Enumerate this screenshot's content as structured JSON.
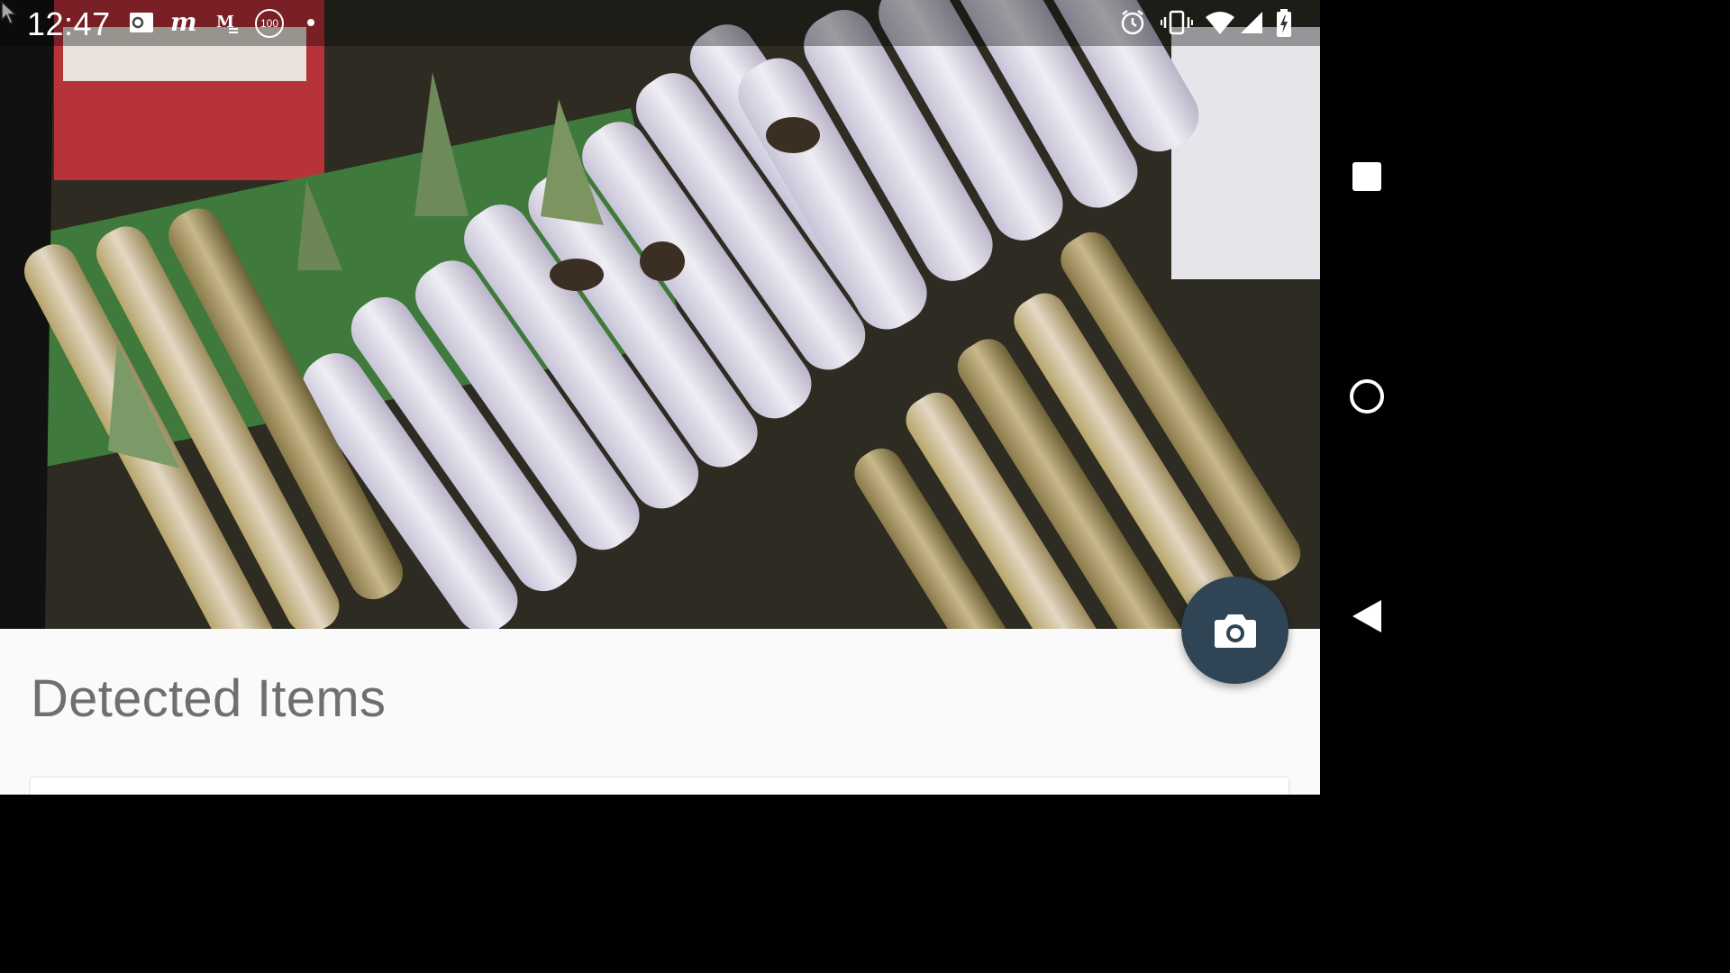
{
  "status_bar": {
    "time": "12:47",
    "left_icons": [
      "outlook-icon",
      "m-app-icon",
      "gmail-icon",
      "battery-100-badge-icon",
      "notification-dot-icon"
    ],
    "right_icons": [
      "alarm-icon",
      "vibrate-icon",
      "wifi-icon",
      "cell-signal-icon",
      "battery-charging-icon"
    ],
    "badge_text": "100"
  },
  "preview": {
    "description_icon": "camera-preview"
  },
  "content": {
    "title": "Detected Items"
  },
  "fab": {
    "icon": "camera-icon"
  },
  "nav_bar": {
    "buttons": [
      "recents-button",
      "home-button",
      "back-button"
    ]
  },
  "colors": {
    "fab": "#2f4454",
    "title": "#6f6f6f",
    "background": "#fafafa"
  }
}
